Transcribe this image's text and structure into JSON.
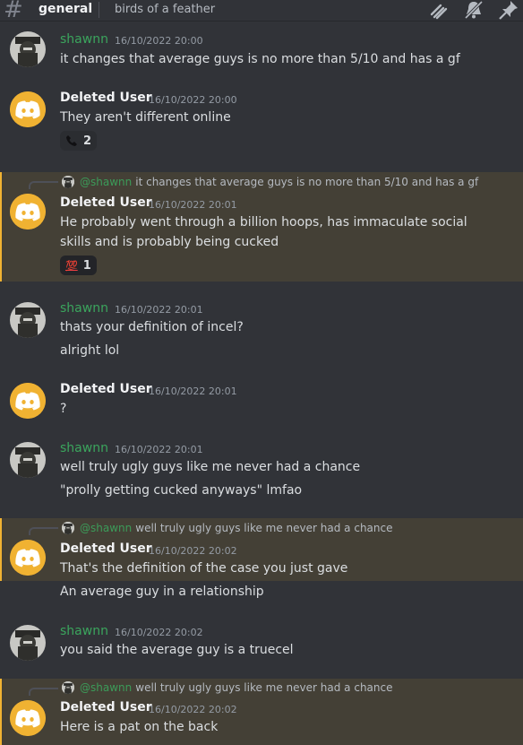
{
  "header": {
    "channel": "general",
    "topic": "birds of a feather",
    "icons": [
      "threads-icon",
      "mute-bell-icon",
      "pin-icon"
    ]
  },
  "messages": [
    {
      "author": "shawnn",
      "timestamp": "16/10/2022 20:00",
      "lines": [
        "it changes that average guys is no more than 5/10 and has a gf"
      ]
    },
    {
      "author": "Deleted User",
      "timestamp": "16/10/2022 20:00",
      "lines": [
        "They aren't different online"
      ],
      "reaction": {
        "emoji": "phone-icon",
        "count": "2"
      }
    },
    {
      "author": "Deleted User",
      "timestamp": "16/10/2022 20:01",
      "reply": {
        "mention": "@shawnn",
        "text": "it changes that average guys is no more than 5/10 and has a gf"
      },
      "lines": [
        "He probably went through a billion hoops, has immaculate social",
        "skills and is probably being cucked"
      ],
      "reaction": {
        "emoji": "💯",
        "count": "1"
      }
    },
    {
      "author": "shawnn",
      "timestamp": "16/10/2022 20:01",
      "lines": [
        "thats your definition of incel?",
        "alright lol"
      ]
    },
    {
      "author": "Deleted User",
      "timestamp": "16/10/2022 20:01",
      "lines": [
        "?"
      ]
    },
    {
      "author": "shawnn",
      "timestamp": "16/10/2022 20:01",
      "lines": [
        "well truly ugly guys like me never had a chance",
        "\"prolly getting cucked anyways\" lmfao"
      ]
    },
    {
      "author": "Deleted User",
      "timestamp": "16/10/2022 20:02",
      "reply": {
        "mention": "@shawnn",
        "text": "well truly ugly guys like me never had a chance"
      },
      "lines": [
        "That's the definition of the case you just gave",
        "An average guy in a relationship"
      ]
    },
    {
      "author": "shawnn",
      "timestamp": "16/10/2022 20:02",
      "lines": [
        "you said the average guy is a truecel"
      ]
    },
    {
      "author": "Deleted User",
      "timestamp": "16/10/2022 20:02",
      "reply": {
        "mention": "@shawnn",
        "text": "well truly ugly guys like me never had a chance"
      },
      "lines": [
        "Here is a pat on the back"
      ]
    }
  ],
  "colors": {
    "background": "#313338",
    "highlight": "#444036",
    "accent": "#f0b232",
    "shawnn": "#3ba55d"
  }
}
